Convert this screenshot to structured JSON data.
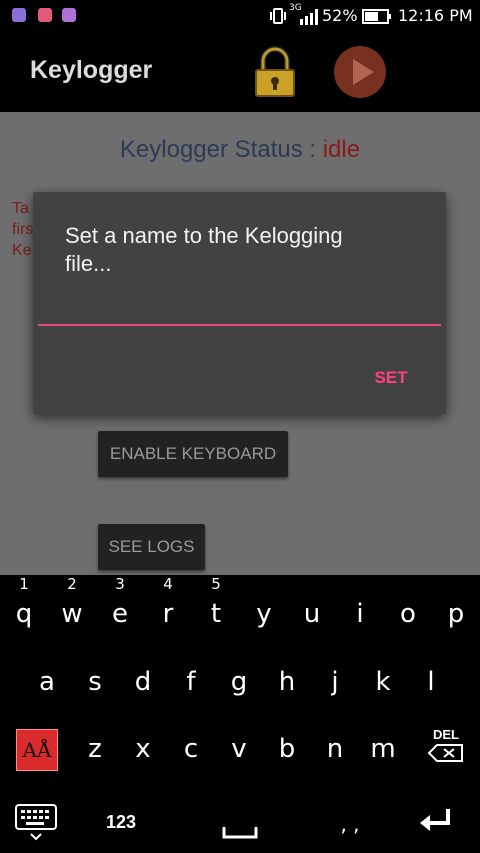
{
  "status_bar": {
    "network": "3G",
    "battery": "52%",
    "time": "12:16 PM"
  },
  "app_bar": {
    "title": "Keylogger",
    "icons": [
      "lock-icon",
      "play-icon"
    ]
  },
  "content": {
    "status_label": "Keylogger Status : ",
    "status_value": "idle",
    "instructions_visible": [
      "Ta",
      "firs",
      "Ke"
    ],
    "enable_keyboard_label": "ENABLE KEYBOARD",
    "see_logs_label": "SEE LOGS"
  },
  "dialog": {
    "message": "Set a name to the Kelogging file...",
    "input_value": "",
    "set_label": "SET",
    "accent_color": "#ff4081"
  },
  "keyboard": {
    "row1": [
      "q",
      "w",
      "e",
      "r",
      "t",
      "y",
      "u",
      "i",
      "o",
      "p"
    ],
    "row1_hints": [
      "1",
      "2",
      "3",
      "4",
      "5"
    ],
    "row2": [
      "a",
      "s",
      "d",
      "f",
      "g",
      "h",
      "j",
      "k",
      "l"
    ],
    "row3": [
      "z",
      "x",
      "c",
      "v",
      "b",
      "n",
      "m"
    ],
    "shift_label": "AÅ",
    "del_label": "DEL",
    "numbers_label": "123",
    "punct_label": ", ,"
  }
}
